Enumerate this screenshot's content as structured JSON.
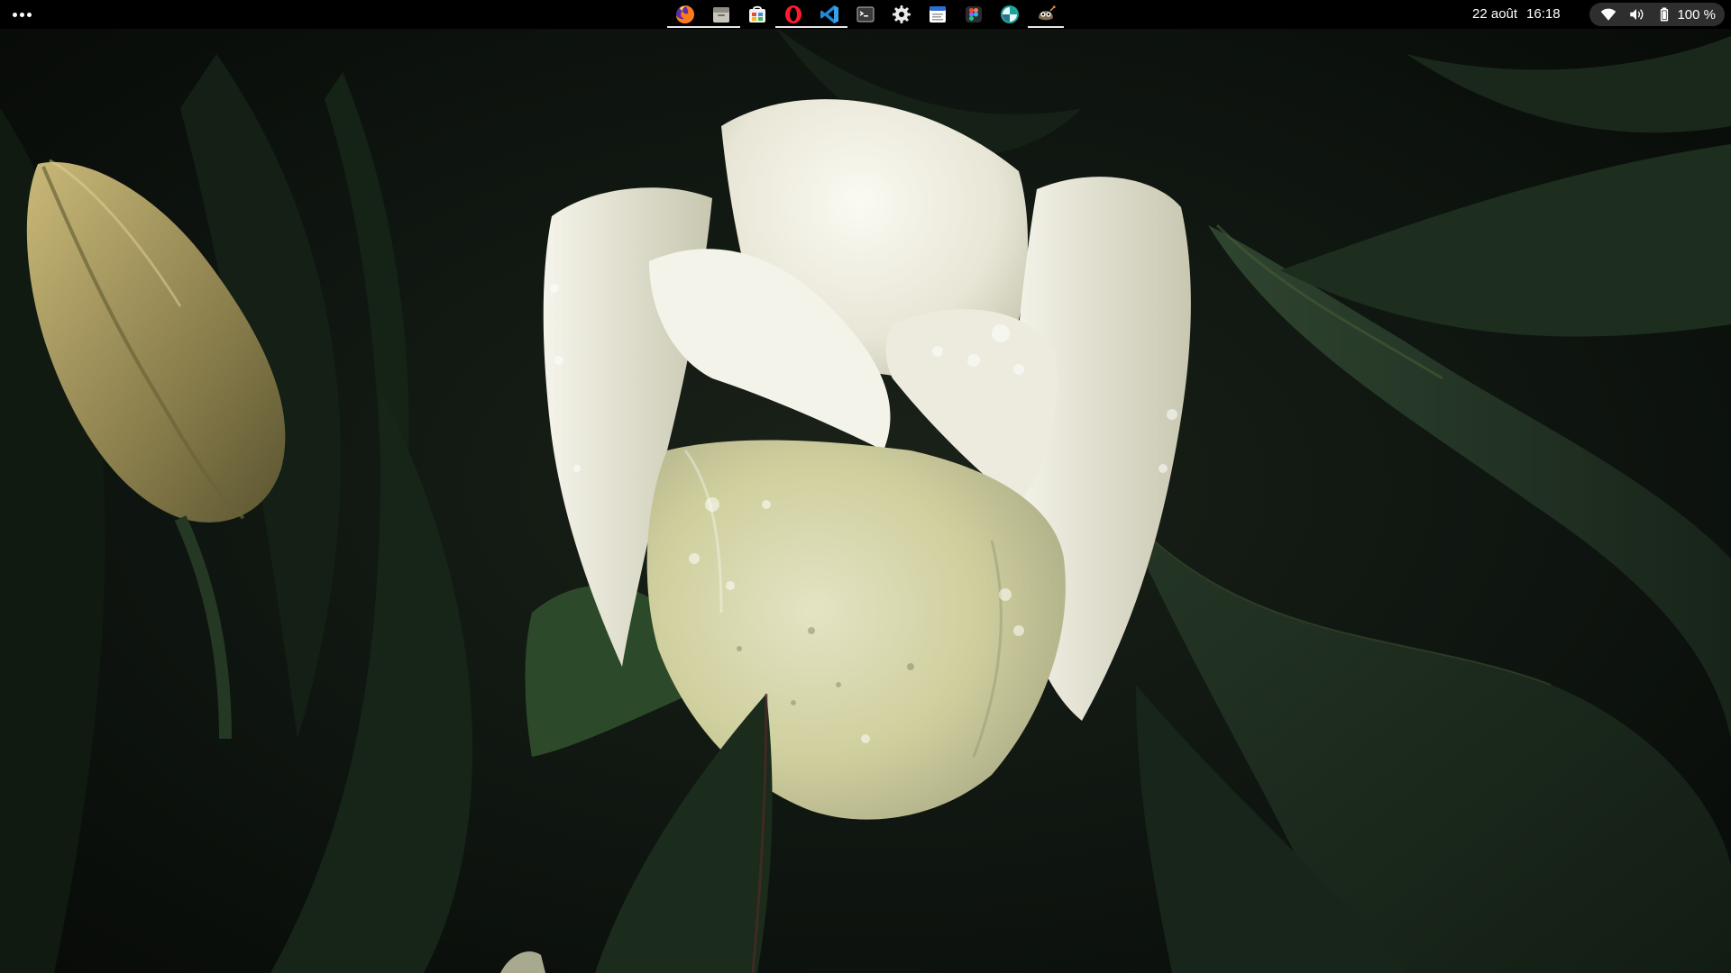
{
  "panel": {
    "activities_icon": "more-horizontal-icon",
    "date": "22 août",
    "time": "16:18",
    "battery_percent": "100 %"
  },
  "dock": {
    "apps": [
      {
        "name": "Firefox",
        "icon": "firefox-icon",
        "running": true
      },
      {
        "name": "Files",
        "icon": "files-icon",
        "running": true
      },
      {
        "name": "Software",
        "icon": "software-store-icon",
        "running": false
      },
      {
        "name": "Opera",
        "icon": "opera-icon",
        "running": true
      },
      {
        "name": "Visual Studio Code",
        "icon": "vscode-icon",
        "running": true
      },
      {
        "name": "Terminal",
        "icon": "terminal-icon",
        "running": false
      },
      {
        "name": "Settings",
        "icon": "settings-gear-icon",
        "running": false
      },
      {
        "name": "Text Editor",
        "icon": "text-editor-icon",
        "running": false
      },
      {
        "name": "Figma",
        "icon": "figma-icon",
        "running": false
      },
      {
        "name": "App",
        "icon": "teal-circle-app-icon",
        "running": false
      },
      {
        "name": "GIMP",
        "icon": "gimp-icon",
        "running": true
      }
    ]
  },
  "status": {
    "wifi_icon": "wifi-icon",
    "volume_icon": "volume-icon",
    "battery_icon": "battery-icon"
  },
  "wallpaper": {
    "subject": "white-tulip-with-water-droplets",
    "colors": {
      "background": "#0b100c",
      "leaf": "#1c2a1d",
      "petal": "#ecebe0",
      "bud": "#9c8f58"
    }
  }
}
